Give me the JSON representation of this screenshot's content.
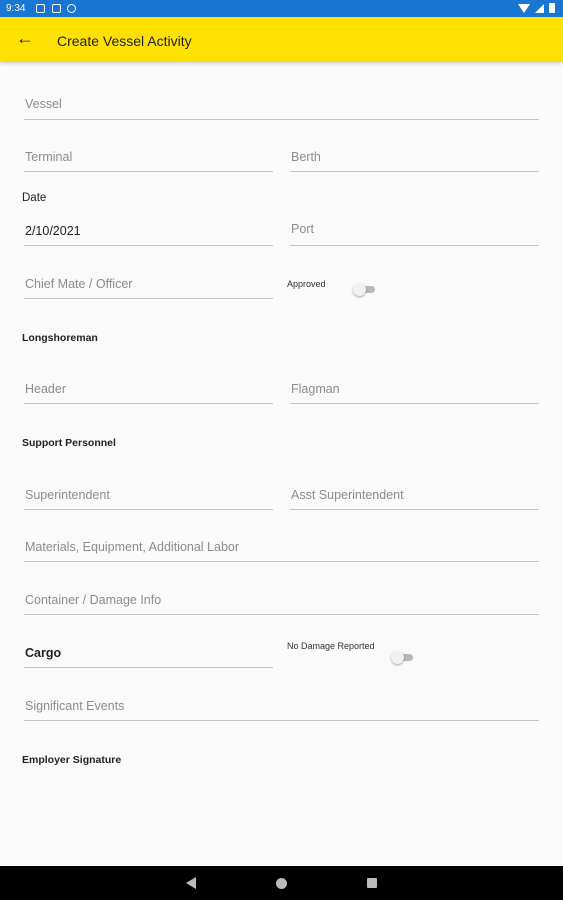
{
  "status_bar": {
    "time": "9:34"
  },
  "app_bar": {
    "title": "Create Vessel Activity"
  },
  "form": {
    "vessel": {
      "placeholder": "Vessel"
    },
    "terminal": {
      "placeholder": "Terminal"
    },
    "berth": {
      "placeholder": "Berth"
    },
    "date_label": "Date",
    "date": {
      "value": "2/10/2021"
    },
    "port": {
      "placeholder": "Port"
    },
    "chief_mate": {
      "placeholder": "Chief Mate / Officer"
    },
    "approved": {
      "label": "Approved",
      "on": false
    },
    "longshoreman_label": "Longshoreman",
    "header": {
      "placeholder": "Header"
    },
    "flagman": {
      "placeholder": "Flagman"
    },
    "support_label": "Support Personnel",
    "superintendent": {
      "placeholder": "Superintendent"
    },
    "asst_superintendent": {
      "placeholder": "Asst Superintendent"
    },
    "materials": {
      "placeholder": "Materials, Equipment, Additional Labor"
    },
    "container_damage": {
      "placeholder": "Container / Damage Info"
    },
    "cargo": {
      "value": "Cargo"
    },
    "no_damage": {
      "label": "No Damage Reported",
      "on": false
    },
    "significant_events": {
      "placeholder": "Significant Events"
    },
    "employer_signature_label": "Employer Signature"
  }
}
